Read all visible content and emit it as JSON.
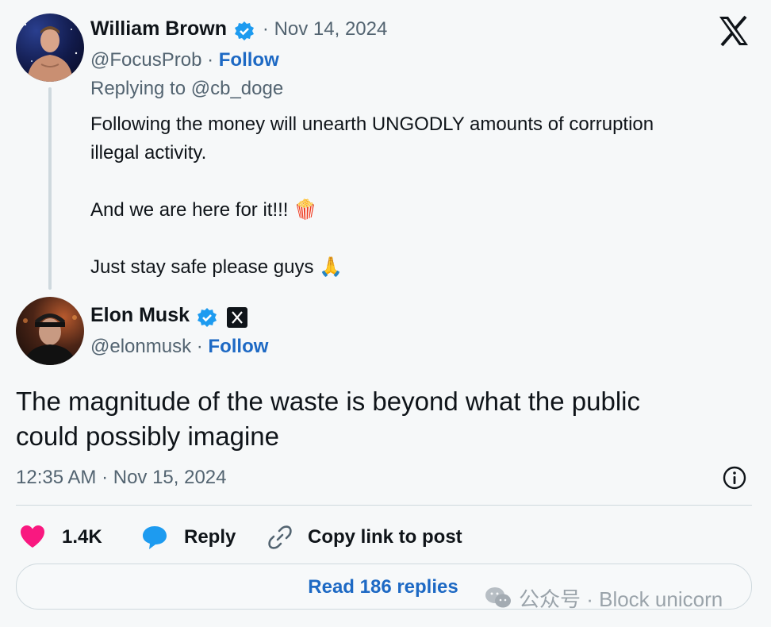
{
  "reply_tweet": {
    "author_name": "William Brown",
    "date": "· Nov 14, 2024",
    "handle": "@FocusProb · ",
    "follow_label": "Follow",
    "replying_to": "Replying to @cb_doge",
    "lines": [
      "Following the money will unearth UNGODLY amounts of corruption",
      "illegal activity.",
      "And we are here for it!!! 🍿",
      "Just stay safe please guys 🙏"
    ]
  },
  "main_tweet": {
    "author_name": "Elon Musk",
    "handle": "@elonmusk · ",
    "follow_label": "Follow",
    "text_line1": "The magnitude of the waste is beyond what the public",
    "text_line2": "could possibly imagine",
    "timestamp": "12:35 AM · Nov 15, 2024"
  },
  "actions": {
    "likes": "1.4K",
    "reply_label": "Reply",
    "copy_label": "Copy link to post"
  },
  "read_replies_label": "Read 186 replies",
  "watermark": "公众号 · Block unicorn",
  "colors": {
    "verified": "#1d9bf0",
    "link": "#1d69c4",
    "heart": "#f91880",
    "reply_bubble": "#1d9bf0"
  },
  "icons": [
    "x-logo-icon",
    "verified-badge-icon",
    "heart-icon",
    "reply-bubble-icon",
    "link-icon",
    "info-icon",
    "wechat-icon"
  ]
}
